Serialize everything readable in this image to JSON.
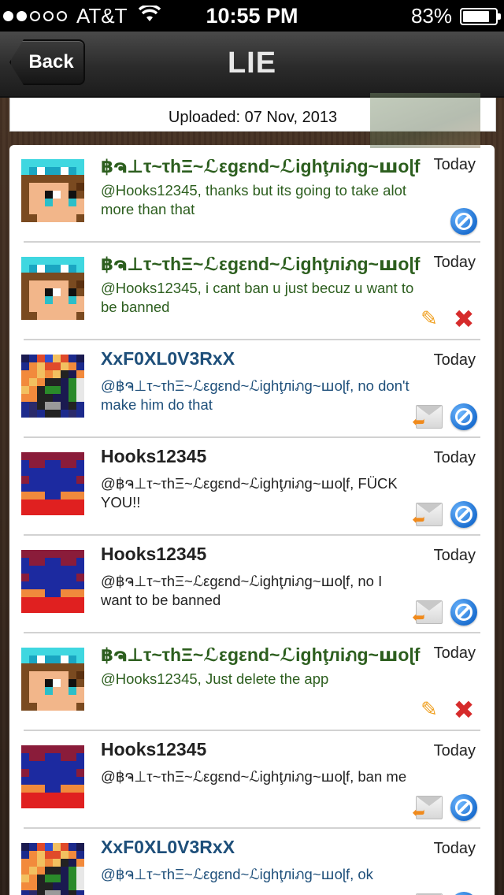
{
  "status_bar": {
    "carrier": "AT&T",
    "time": "10:55 PM",
    "battery_percent": "83%",
    "battery_level": 0.83,
    "signal_dots_filled": 2,
    "signal_dots_total": 5
  },
  "nav": {
    "back_label": "Back",
    "title": "LIE"
  },
  "uploaded_label": "Uploaded: 07 Nov, 2013",
  "comments": [
    {
      "user": "฿ຈ⊥τ~τhΞ~ℒεgεnd~ℒighţлiภg~ꟺoɭf",
      "time": "Today",
      "text": "@Hooks12345, thanks but its going to take alot more than that",
      "color": "green",
      "avatar": "diamond",
      "actions": [
        "block"
      ]
    },
    {
      "user": "฿ຈ⊥τ~τhΞ~ℒεgεnd~ℒighţлiภg~ꟺoɭf",
      "time": "Today",
      "text": "@Hooks12345, i cant ban u just becuz u want to be banned",
      "color": "green",
      "avatar": "diamond",
      "actions": [
        "edit",
        "delete"
      ]
    },
    {
      "user": "XxF0XL0V3RxX",
      "time": "Today",
      "text": "@฿ຈ⊥τ~τhΞ~ℒεgεnd~ℒighţлiภg~ꟺoɭf, no don't make him do that",
      "color": "blue",
      "avatar": "fox",
      "actions": [
        "reply",
        "block"
      ]
    },
    {
      "user": "Hooks12345",
      "time": "Today",
      "text": "@฿ຈ⊥τ~τhΞ~ℒεgεnd~ℒighţлiภg~ꟺoɭf, FÜCK YOU!!",
      "color": "dark",
      "avatar": "spider",
      "actions": [
        "reply",
        "block"
      ]
    },
    {
      "user": "Hooks12345",
      "time": "Today",
      "text": "@฿ຈ⊥τ~τhΞ~ℒεgεnd~ℒighţлiภg~ꟺoɭf, no I want to be banned",
      "color": "dark",
      "avatar": "spider",
      "actions": [
        "reply",
        "block"
      ]
    },
    {
      "user": "฿ຈ⊥τ~τhΞ~ℒεgεnd~ℒighţлiภg~ꟺoɭf",
      "time": "Today",
      "text": "@Hooks12345, Just delete the app",
      "color": "green",
      "avatar": "diamond",
      "actions": [
        "edit",
        "delete"
      ]
    },
    {
      "user": "Hooks12345",
      "time": "Today",
      "text": "@฿ຈ⊥τ~τhΞ~ℒεgεnd~ℒighţлiภg~ꟺoɭf, ban me",
      "color": "dark",
      "avatar": "spider",
      "actions": [
        "reply",
        "block"
      ]
    },
    {
      "user": "XxF0XL0V3RxX",
      "time": "Today",
      "text": "@฿ຈ⊥τ~τhΞ~ℒεgεnd~ℒighţлiภg~ꟺoɭf, ok",
      "color": "blue",
      "avatar": "fox",
      "actions": [
        "reply",
        "block"
      ]
    }
  ],
  "icons": {
    "block": "block-icon",
    "reply": "reply-mail-icon",
    "edit": "pencil-icon",
    "delete": "delete-x-icon"
  },
  "colors": {
    "green_user": "#2c5e1e",
    "blue_user": "#1e4f7a",
    "dark_user": "#222222",
    "block_blue": "#1c6fd0",
    "delete_red": "#d62b2b",
    "edit_orange": "#f0a020"
  }
}
